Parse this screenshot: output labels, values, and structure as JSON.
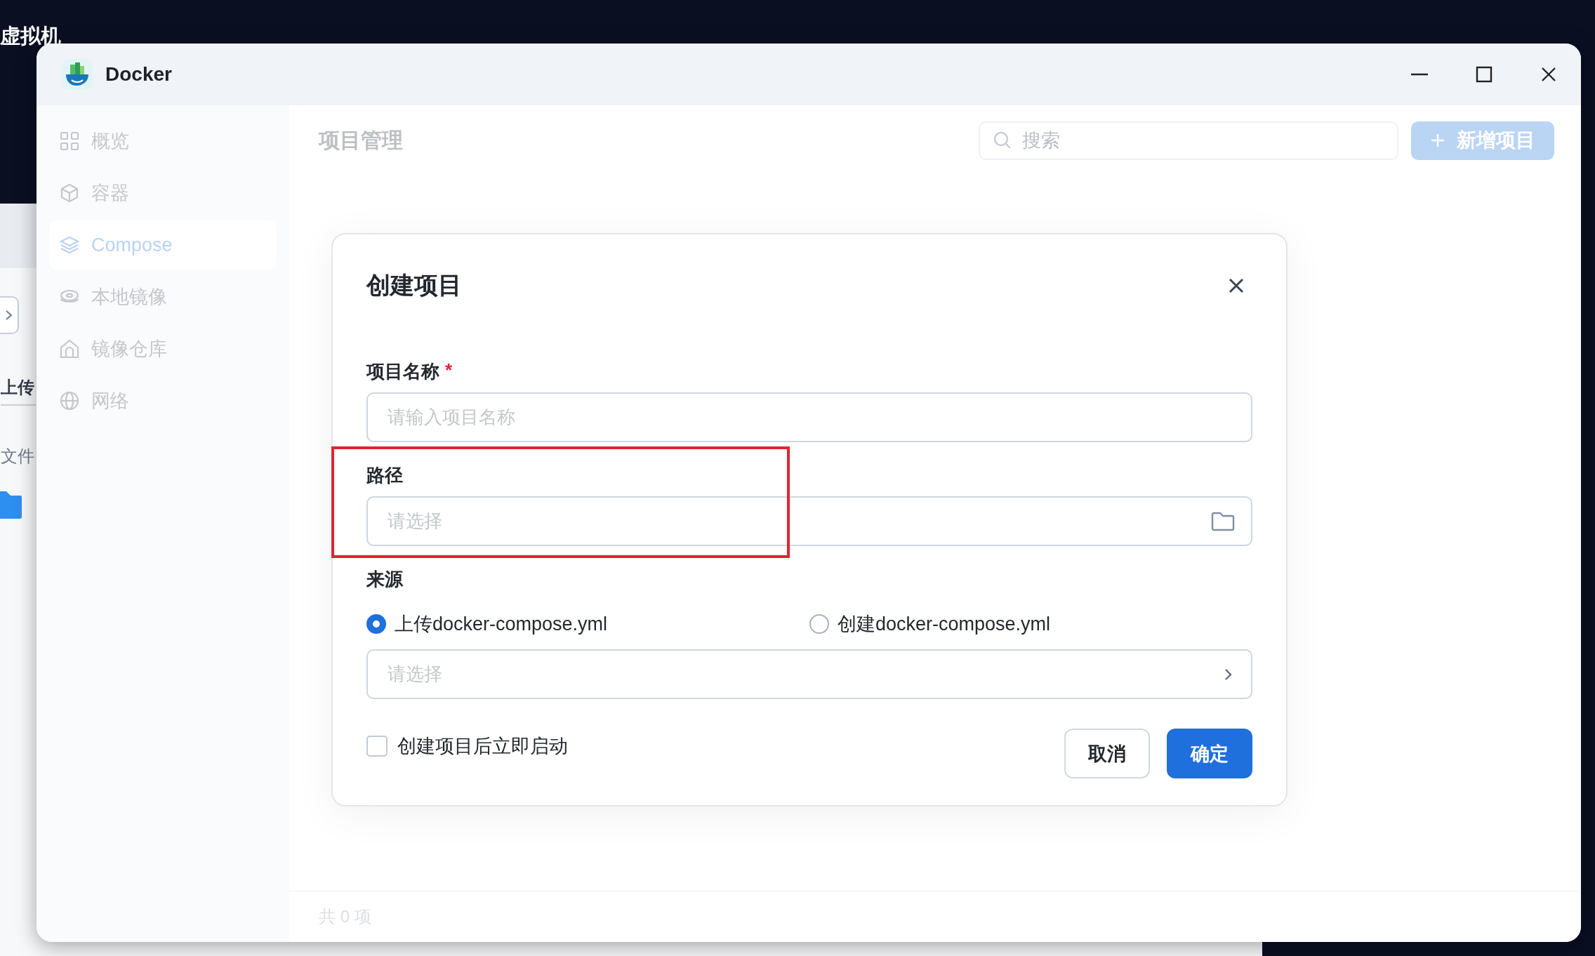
{
  "desktop": {
    "label": "虚拟机"
  },
  "background_window": {
    "button_label": "上传",
    "column_header": "文件"
  },
  "window": {
    "title": "Docker"
  },
  "sidebar": {
    "items": [
      {
        "kind": "grid",
        "label": "概览",
        "selected": false
      },
      {
        "kind": "cube",
        "label": "容器",
        "selected": false
      },
      {
        "kind": "layers",
        "label": "Compose",
        "selected": true
      },
      {
        "kind": "disk",
        "label": "本地镜像",
        "selected": false
      },
      {
        "kind": "house",
        "label": "镜像仓库",
        "selected": false
      },
      {
        "kind": "globe",
        "label": "网络",
        "selected": false
      }
    ]
  },
  "page": {
    "title": "项目管理",
    "search": {
      "placeholder": "搜索"
    },
    "add_button": {
      "label": "新增项目"
    },
    "footer": "共 0 项"
  },
  "dialog": {
    "title": "创建项目",
    "fields": [
      {
        "kind": "text",
        "label": "项目名称",
        "required_mark": "*",
        "placeholder": "请输入项目名称",
        "highlighted": false
      },
      {
        "kind": "folder",
        "label": "路径",
        "placeholder": "请选择",
        "highlighted": true
      }
    ],
    "source": {
      "label": "来源",
      "options": [
        {
          "label": "上传docker-compose.yml",
          "selected": true
        },
        {
          "label": "创建docker-compose.yml",
          "selected": false
        }
      ],
      "select": {
        "placeholder": "请选择"
      }
    },
    "start_after_create": {
      "label": "创建项目后立即启动",
      "checked": false
    },
    "buttons": [
      {
        "kind": "secondary",
        "label": "取消"
      },
      {
        "kind": "primary",
        "label": "确定"
      }
    ]
  }
}
